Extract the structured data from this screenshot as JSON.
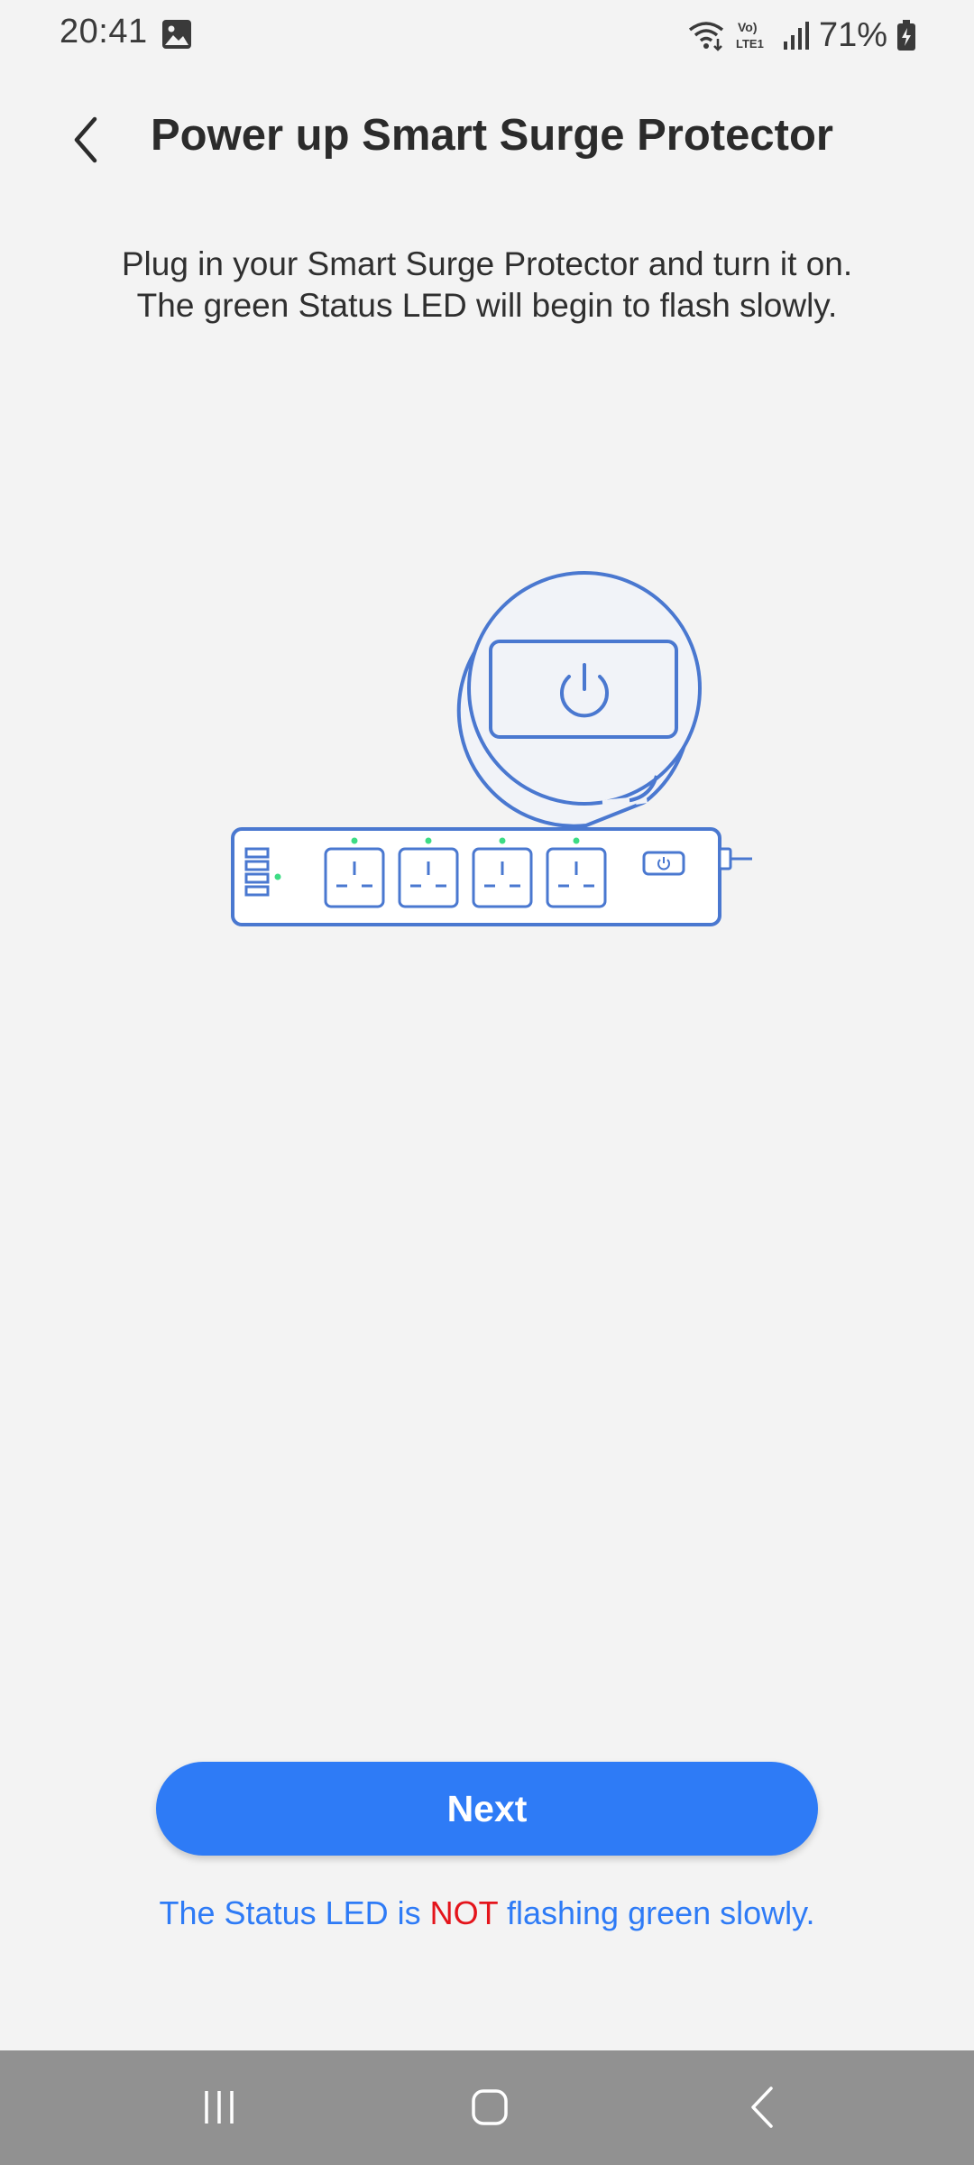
{
  "status_bar": {
    "time": "20:41",
    "network_label": "Vo) LTE1",
    "battery_percent": "71%",
    "icons": [
      "gallery-icon",
      "wifi-icon",
      "volte-icon",
      "signal-icon",
      "battery-charging-icon"
    ]
  },
  "header": {
    "title": "Power up Smart Surge Protector",
    "back_icon": "chevron-left-icon"
  },
  "instruction": {
    "line1": "Plug in your Smart Surge Protector and turn it on.",
    "line2": "The green Status LED will begin to flash slowly."
  },
  "illustration": {
    "subject": "surge-protector-power-button",
    "outline_color": "#4a78d0",
    "led_color": "#3ddc84"
  },
  "actions": {
    "next_label": "Next",
    "help_prefix": "The Status LED is ",
    "help_emphasis": "NOT",
    "help_suffix": " flashing green slowly."
  },
  "colors": {
    "accent": "#2e7bf6",
    "warning": "#e4141b",
    "background": "#f3f3f3",
    "nav_bar": "#919191"
  },
  "nav_bar": {
    "buttons": [
      "recent-apps-icon",
      "home-icon",
      "back-icon"
    ]
  }
}
